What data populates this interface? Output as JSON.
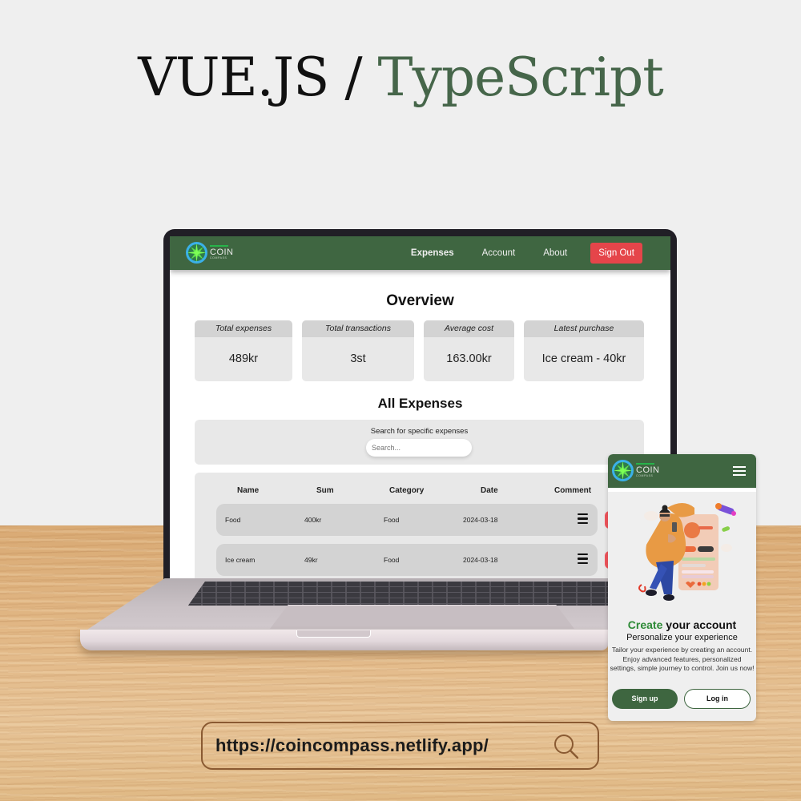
{
  "headline": {
    "part1": "VUE.JS /",
    "part2": "TypeScript",
    "colors": {
      "part1": "#111111",
      "part2": "#46664a"
    }
  },
  "app": {
    "brand": {
      "name": "COIN",
      "tagline": "COMPASS"
    },
    "nav": {
      "links": [
        "Expenses",
        "Account",
        "About"
      ],
      "active": "Expenses",
      "signout_label": "Sign Out"
    },
    "overview": {
      "title": "Overview",
      "cards": [
        {
          "label": "Total expenses",
          "value": "489kr"
        },
        {
          "label": "Total transactions",
          "value": "3st"
        },
        {
          "label": "Average cost",
          "value": "163.00kr"
        },
        {
          "label": "Latest purchase",
          "value": "Ice cream - 40kr"
        }
      ]
    },
    "expenses": {
      "title": "All Expenses",
      "search": {
        "label": "Search for specific expenses",
        "placeholder": "Search...",
        "value": ""
      },
      "columns": [
        "Name",
        "Sum",
        "Category",
        "Date",
        "Comment"
      ],
      "rows": [
        {
          "name": "Food",
          "sum": "400kr",
          "category": "Food",
          "date": "2024-03-18"
        },
        {
          "name": "Ice cream",
          "sum": "49kr",
          "category": "Food",
          "date": "2024-03-18"
        }
      ]
    },
    "colors": {
      "nav": "#3f6641",
      "signout": "#e5454a",
      "delete": "#f0545c"
    }
  },
  "mobile": {
    "brand": {
      "name": "COIN",
      "tagline": "COMPASS"
    },
    "menu_icon": "hamburger-icon",
    "title_highlight": "Create",
    "title_rest": " your account",
    "subtitle": "Personalize your experience",
    "description": "Tailor your experience by creating an account. Enjoy advanced features, personalized settings, simple journey to control. Join us now!",
    "signup_label": "Sign up",
    "login_label": "Log in",
    "colors": {
      "accent": "#2d8a36",
      "button": "#3e6640"
    }
  },
  "url_bar": {
    "url": "https://coincompass.netlify.app/",
    "icon": "search-icon"
  }
}
